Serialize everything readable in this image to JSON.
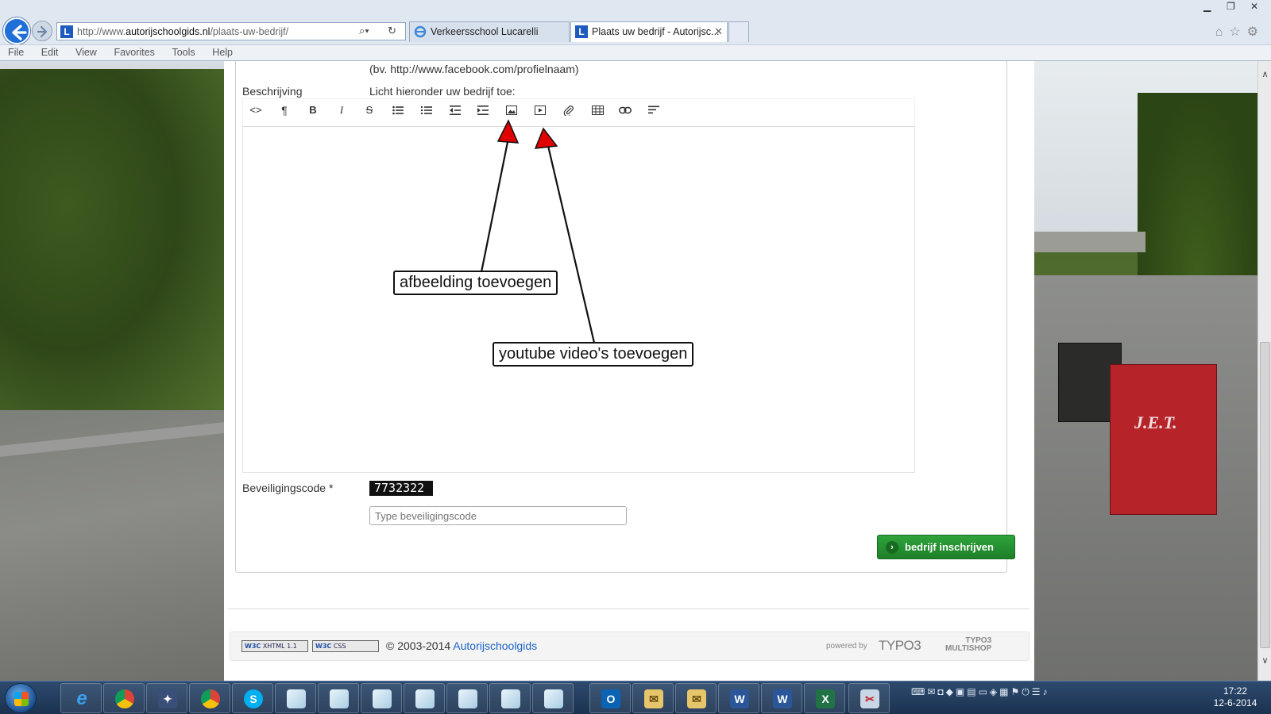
{
  "browser": {
    "url_prefix": "http://www.",
    "url_domain": "autorijschoolgids.nl",
    "url_path": "/plaats-uw-bedrijf/",
    "tabs": [
      {
        "label": "Verkeersschool Lucarelli",
        "active": false,
        "icon": "ie-page-icon"
      },
      {
        "label": "Plaats uw bedrijf - Autorijsc...",
        "active": true,
        "icon": "l-logo-icon"
      }
    ],
    "menu": [
      "File",
      "Edit",
      "View",
      "Favorites",
      "Tools",
      "Help"
    ]
  },
  "form": {
    "facebook_hint": "(bv. http://www.facebook.com/profielnaam)",
    "description_label": "Beschrijving",
    "description_hint": "Licht hieronder uw bedrijf toe:",
    "toolbar": [
      "html-source-icon",
      "paragraph-icon",
      "bold-icon",
      "italic-icon",
      "strikethrough-icon",
      "bullet-list-icon",
      "numbered-list-icon",
      "outdent-icon",
      "indent-icon",
      "image-icon",
      "video-icon",
      "file-link-icon",
      "table-icon",
      "link-icon",
      "align-icon"
    ],
    "callouts": {
      "image": "afbeelding toevoegen",
      "video": "youtube video's toevoegen"
    },
    "captcha_label": "Beveiligingscode *",
    "captcha_code": "7732322",
    "captcha_placeholder": "Type beveiligingscode",
    "submit_label": "bedrijf inschrijven"
  },
  "footer": {
    "badge_xhtml": "XHTML 1.1",
    "badge_css": "CSS",
    "copyright": "© 2003-2014",
    "copyright_link": "Autorijschoolgids",
    "powered": "powered by",
    "typo3": "TYPO3",
    "multishop_line1": "TYPO3",
    "multishop_line2": "MULTISHOP"
  },
  "taskbar": {
    "apps": [
      "ie-icon",
      "chrome-icon",
      "app-icon",
      "chrome-icon",
      "skype-icon",
      "paper-icon",
      "paper-icon",
      "paper-icon",
      "paper-icon",
      "paper-icon",
      "paper-icon",
      "paper-icon",
      "outlook-icon",
      "mail-icon",
      "mail-icon",
      "word-icon",
      "word-icon",
      "excel-icon",
      "snipping-icon"
    ],
    "time": "17:22",
    "date": "12-6-2014"
  },
  "colors": {
    "submit_green": "#1d7f27",
    "link_blue": "#1b63c6",
    "arrow_red": "#e00000"
  }
}
